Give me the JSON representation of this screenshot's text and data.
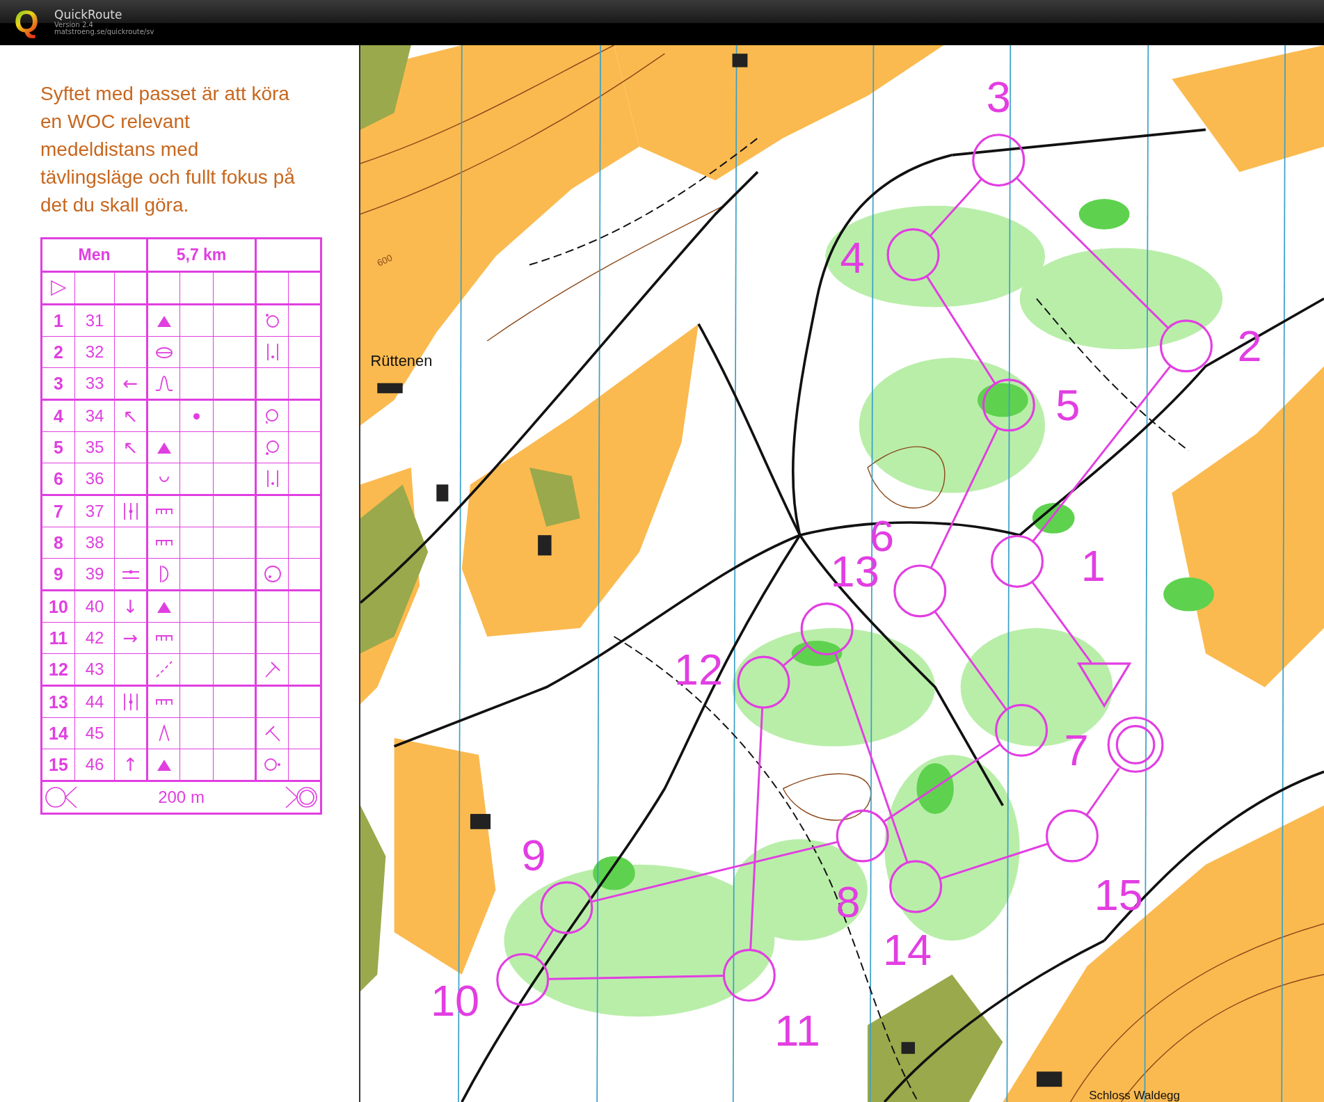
{
  "app": {
    "logo": "Q",
    "title": "QuickRoute",
    "version": "Version 2.4",
    "url": "matstroeng.se/quickroute/sv"
  },
  "description": [
    "Syftet med passet är att köra",
    "en WOC relevant",
    "medeldistans med",
    "tävlingsläge och fullt fokus på",
    "det du skall göra."
  ],
  "control_card": {
    "class": "Men",
    "length": "5,7 km",
    "finish_distance": "200 m",
    "rows": [
      {
        "number": "1",
        "code": "31",
        "cells": [
          {
            "kind": "none"
          },
          {
            "kind": "boulder"
          },
          {
            "kind": "none"
          },
          {
            "kind": "dot-nw"
          }
        ]
      },
      {
        "number": "2",
        "code": "32",
        "cells": [
          {
            "kind": "none"
          },
          {
            "kind": "knoll"
          },
          {
            "kind": "none"
          },
          {
            "kind": "between"
          }
        ]
      },
      {
        "number": "3",
        "code": "33",
        "direction": "←",
        "cells": [
          {
            "kind": "none"
          },
          {
            "kind": "spur"
          },
          {
            "kind": "none"
          },
          {
            "kind": "none"
          }
        ]
      },
      {
        "number": "4",
        "code": "34",
        "direction": "↖",
        "cells": [
          {
            "kind": "none"
          },
          {
            "kind": "none"
          },
          {
            "kind": "dot"
          },
          {
            "kind": "corner-sw"
          }
        ]
      },
      {
        "number": "5",
        "code": "35",
        "direction": "↖",
        "cells": [
          {
            "kind": "none"
          },
          {
            "kind": "boulder"
          },
          {
            "kind": "none"
          },
          {
            "kind": "dot-sw"
          }
        ]
      },
      {
        "number": "6",
        "code": "36",
        "cells": [
          {
            "kind": "none"
          },
          {
            "kind": "depression"
          },
          {
            "kind": "none"
          },
          {
            "kind": "between"
          }
        ]
      },
      {
        "number": "7",
        "code": "37",
        "cells": [
          {
            "kind": "crossing"
          },
          {
            "kind": "wall"
          },
          {
            "kind": "none"
          },
          {
            "kind": "none"
          }
        ]
      },
      {
        "number": "8",
        "code": "38",
        "cells": [
          {
            "kind": "none"
          },
          {
            "kind": "wall"
          },
          {
            "kind": "none"
          },
          {
            "kind": "none"
          }
        ]
      },
      {
        "number": "9",
        "code": "39",
        "cells": [
          {
            "kind": "junction"
          },
          {
            "kind": "bracket"
          },
          {
            "kind": "none"
          },
          {
            "kind": "dot-inside"
          }
        ]
      },
      {
        "number": "10",
        "code": "40",
        "direction": "↓",
        "cells": [
          {
            "kind": "none"
          },
          {
            "kind": "boulder"
          },
          {
            "kind": "none"
          },
          {
            "kind": "none"
          }
        ]
      },
      {
        "number": "11",
        "code": "42",
        "direction": "→",
        "cells": [
          {
            "kind": "none"
          },
          {
            "kind": "wall"
          },
          {
            "kind": "none"
          },
          {
            "kind": "none"
          }
        ]
      },
      {
        "number": "12",
        "code": "43",
        "cells": [
          {
            "kind": "none"
          },
          {
            "kind": "path"
          },
          {
            "kind": "none"
          },
          {
            "kind": "t-ne"
          }
        ]
      },
      {
        "number": "13",
        "code": "44",
        "cells": [
          {
            "kind": "crossing"
          },
          {
            "kind": "wall"
          },
          {
            "kind": "none"
          },
          {
            "kind": "none"
          }
        ]
      },
      {
        "number": "14",
        "code": "45",
        "cells": [
          {
            "kind": "none"
          },
          {
            "kind": "pass"
          },
          {
            "kind": "none"
          },
          {
            "kind": "t-nw"
          }
        ]
      },
      {
        "number": "15",
        "code": "46",
        "direction": "↑",
        "cells": [
          {
            "kind": "none"
          },
          {
            "kind": "boulder"
          },
          {
            "kind": "none"
          },
          {
            "kind": "dot-e"
          }
        ]
      }
    ]
  },
  "map": {
    "labels": [
      {
        "text": "Rüttenen"
      },
      {
        "text": "600"
      },
      {
        "text": "Schloss Waldegg"
      }
    ],
    "controls": [
      {
        "number": "1"
      },
      {
        "number": "2"
      },
      {
        "number": "3"
      },
      {
        "number": "4"
      },
      {
        "number": "5"
      },
      {
        "number": "6"
      },
      {
        "number": "7"
      },
      {
        "number": "8"
      },
      {
        "number": "9"
      },
      {
        "number": "10"
      },
      {
        "number": "11"
      },
      {
        "number": "12"
      },
      {
        "number": "13"
      },
      {
        "number": "14"
      },
      {
        "number": "15"
      }
    ]
  }
}
